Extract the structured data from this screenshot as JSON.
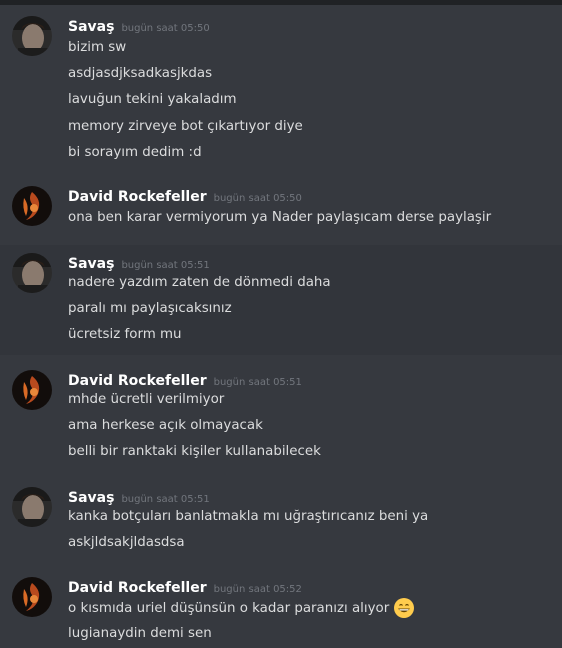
{
  "colors": {
    "background": "#36393f",
    "highlight_row": "#32353b",
    "username": "#ffffff",
    "timestamp": "#72767d",
    "message_text": "#dcddde",
    "top_bar": "#202225"
  },
  "messages": [
    {
      "username": "Savaş",
      "timestamp": "bugün saat 05:50",
      "avatar_icon": "user-avatar-savas",
      "lines": [
        "bizim sw",
        "asdjasdjksadkasjkdas",
        "lavuğun tekini yakaladım",
        "memory zirveye bot çıkartıyor diye",
        "bi sorayım dedim :d"
      ]
    },
    {
      "username": "David Rockefeller",
      "timestamp": "bugün saat 05:50",
      "avatar_icon": "user-avatar-david",
      "lines": [
        "ona ben karar vermiyorum ya Nader paylaşıcam derse paylaşir"
      ]
    },
    {
      "username": "Savaş",
      "timestamp": "bugün saat 05:51",
      "avatar_icon": "user-avatar-savas",
      "lines": [
        "nadere yazdım zaten de dönmedi daha",
        "paralı mı paylaşıcaksınız",
        "ücretsiz form mu"
      ]
    },
    {
      "username": "David Rockefeller",
      "timestamp": "bugün saat 05:51",
      "avatar_icon": "user-avatar-david",
      "lines": [
        "mhde ücretli verilmiyor",
        "ama herkese açık olmayacak",
        "belli bir ranktaki kişiler kullanabilecek"
      ]
    },
    {
      "username": "Savaş",
      "timestamp": "bugün saat 05:51",
      "avatar_icon": "user-avatar-savas",
      "lines": [
        "kanka botçuları banlatmakla mı uğraştırıcanız beni ya",
        "askjldsakjldasdsa"
      ]
    },
    {
      "username": "David Rockefeller",
      "timestamp": "bugün saat 05:52",
      "avatar_icon": "user-avatar-david",
      "lines": [
        "o kısmıda uriel düşünsün o kadar paranızı alıyor",
        "lugianaydin demi sen"
      ],
      "emoji_icon": "grinning-smile-emoji-icon"
    }
  ]
}
